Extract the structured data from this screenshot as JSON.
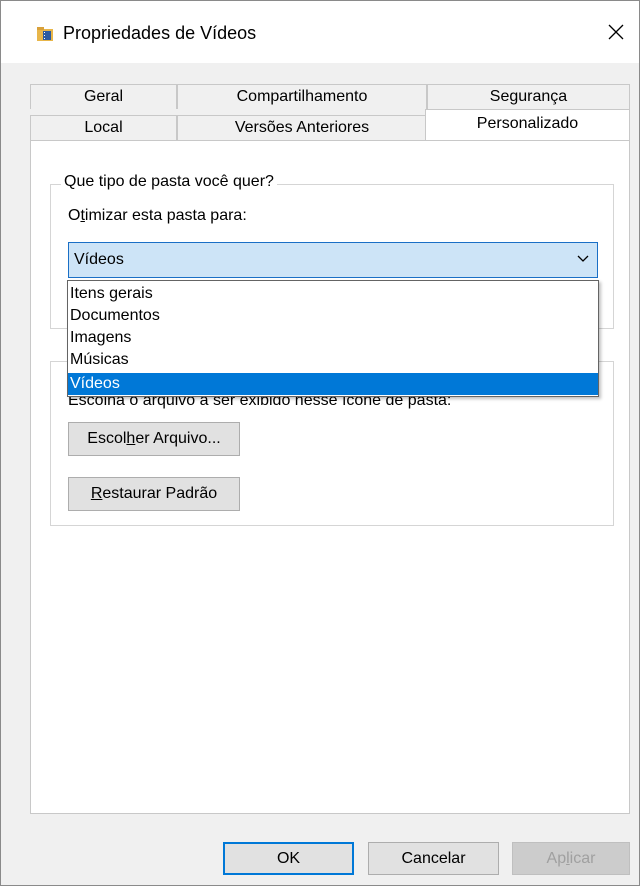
{
  "window": {
    "title": "Propriedades de Vídeos"
  },
  "tabs": {
    "row1": [
      {
        "label": "Geral"
      },
      {
        "label": "Compartilhamento"
      },
      {
        "label": "Segurança"
      }
    ],
    "row2": [
      {
        "label": "Local"
      },
      {
        "label": "Versões Anteriores"
      },
      {
        "label": "Personalizado",
        "active": true
      }
    ]
  },
  "folder_type": {
    "legend": "Que tipo de pasta você quer?",
    "optimize_label_pre": "O",
    "optimize_label_u": "t",
    "optimize_label_post": "imizar esta pasta para:",
    "selected_value": "Vídeos",
    "options": [
      "Itens gerais",
      "Documentos",
      "Imagens",
      "Músicas",
      "Vídeos"
    ]
  },
  "folder_icon": {
    "hint": "Escolha o arquivo a ser exibido nesse ícone de pasta:",
    "choose_file_pre": "Escol",
    "choose_file_u": "h",
    "choose_file_post": "er Arquivo...",
    "restore_u": "R",
    "restore_post": "estaurar Padrão"
  },
  "footer": {
    "ok": "OK",
    "cancel": "Cancelar",
    "apply_pre": "Ap",
    "apply_u": "l",
    "apply_post": "icar"
  },
  "colors": {
    "accent": "#0078d7",
    "combo_bg": "#cde4f7",
    "folder_icon": "#e8b64a"
  }
}
